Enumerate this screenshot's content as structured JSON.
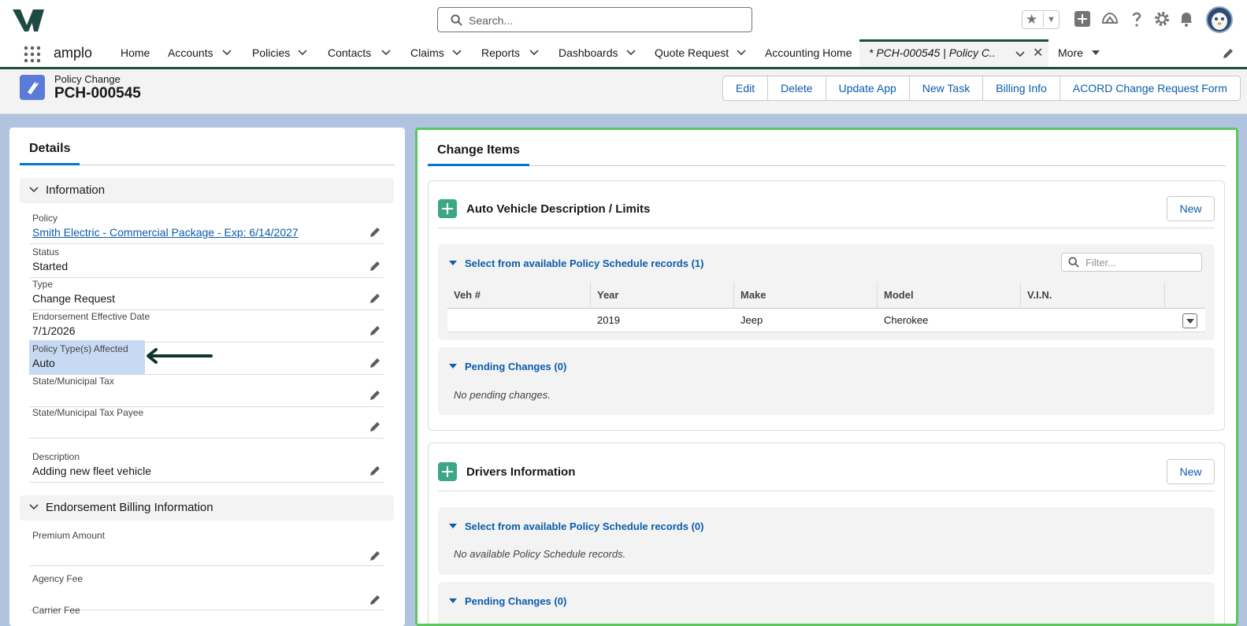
{
  "header": {
    "search_placeholder": "Search...",
    "app_name": "amplo"
  },
  "nav": {
    "items": [
      {
        "label": "Home",
        "has_menu": false
      },
      {
        "label": "Accounts",
        "has_menu": true
      },
      {
        "label": "Policies",
        "has_menu": true
      },
      {
        "label": "Contacts",
        "has_menu": true
      },
      {
        "label": "Claims",
        "has_menu": true
      },
      {
        "label": "Reports",
        "has_menu": true
      },
      {
        "label": "Dashboards",
        "has_menu": true
      },
      {
        "label": "Quote Request",
        "has_menu": true
      },
      {
        "label": "Accounting Home",
        "has_menu": false
      }
    ],
    "active_tab_label": "* PCH-000545 | Policy C...",
    "more_label": "More"
  },
  "record": {
    "object_type": "Policy Change",
    "name": "PCH-000545",
    "actions": [
      "Edit",
      "Delete",
      "Update App",
      "New Task",
      "Billing Info",
      "ACORD Change Request Form"
    ]
  },
  "details": {
    "tab_label": "Details",
    "sections": [
      {
        "title": "Information",
        "fields": [
          {
            "label": "Policy",
            "value": "Smith Electric - Commercial Package - Exp: 6/14/2027",
            "is_link": true
          },
          {
            "label": "Status",
            "value": "Started"
          },
          {
            "label": "Type",
            "value": "Change Request"
          },
          {
            "label": "Endorsement Effective Date",
            "value": "7/1/2026"
          },
          {
            "label": "Policy Type(s) Affected",
            "value": "Auto",
            "highlighted": true
          },
          {
            "label": "State/Municipal Tax",
            "value": ""
          },
          {
            "label": "State/Municipal Tax Payee",
            "value": ""
          },
          {
            "label": "Description",
            "value": "Adding new fleet vehicle"
          }
        ]
      },
      {
        "title": "Endorsement Billing Information",
        "fields": [
          {
            "label": "Premium Amount",
            "value": ""
          },
          {
            "label": "Agency Fee",
            "value": ""
          },
          {
            "label": "Carrier Fee",
            "value": ""
          }
        ]
      }
    ]
  },
  "change_items": {
    "tab_label": "Change Items",
    "blocks": [
      {
        "title": "Auto Vehicle Description / Limits",
        "new_label": "New",
        "schedule_title": "Select from available Policy Schedule records (1)",
        "filter_placeholder": "Filter...",
        "columns": [
          "Veh #",
          "Year",
          "Make",
          "Model",
          "V.I.N."
        ],
        "rows": [
          {
            "veh": "",
            "year": "2019",
            "make": "Jeep",
            "model": "Cherokee",
            "vin": ""
          }
        ],
        "pending_title": "Pending Changes (0)",
        "pending_empty": "No pending changes."
      },
      {
        "title": "Drivers Information",
        "new_label": "New",
        "schedule_title": "Select from available Policy Schedule records (0)",
        "schedule_empty": "No available Policy Schedule records.",
        "pending_title": "Pending Changes (0)"
      }
    ]
  },
  "colors": {
    "brand": "#1f4a43",
    "link": "#0b5cab",
    "highlight": "#c7daf3",
    "selection_border": "#5bc85e",
    "record_icon": "#5a7bd8",
    "block_icon": "#3ba787"
  },
  "icons": [
    "logo-icon",
    "search-icon",
    "star-icon",
    "add-icon",
    "trailhead-icon",
    "help-icon",
    "gear-icon",
    "bell-icon",
    "avatar",
    "app-launcher-icon",
    "chevron-down-icon",
    "close-icon",
    "pencil-icon",
    "arrow-left-icon",
    "filter-search-icon",
    "row-action-icon"
  ]
}
